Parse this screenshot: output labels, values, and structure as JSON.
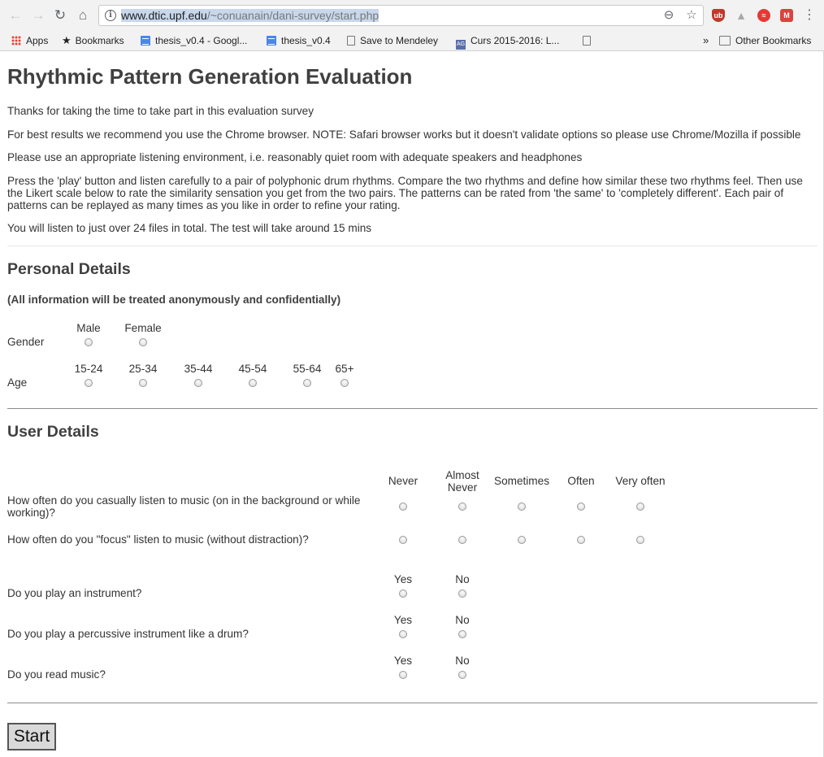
{
  "browser": {
    "url_host": "www.dtic.upf.edu",
    "url_path": "/~conuanain/dani-survey/start.php",
    "bookmarks": [
      {
        "label": "Apps"
      },
      {
        "label": "Bookmarks"
      },
      {
        "label": "thesis_v0.4 - Googl..."
      },
      {
        "label": "thesis_v0.4"
      },
      {
        "label": "Save to Mendeley"
      },
      {
        "label": "Curs 2015-2016: L..."
      }
    ],
    "overflow_label": "»",
    "other_bookmarks": "Other Bookmarks"
  },
  "page": {
    "title": "Rhythmic Pattern Generation Evaluation",
    "intro": [
      "Thanks for taking the time to take part in this evaluation survey",
      "For best results we recommend you use the Chrome browser. NOTE: Safari browser works but it doesn't validate options so please use Chrome/Mozilla if possible",
      "Please use an appropriate listening environment, i.e. reasonably quiet room with adequate speakers and headphones",
      "Press the 'play' button and listen carefully to a pair of polyphonic drum rhythms. Compare the two rhythms and define how similar these two rhythms feel. Then use the Likert scale below to rate the similarity sensation you get from the two pairs. The patterns can be rated from 'the same' to 'completely different'. Each pair of patterns can be replayed as many times as you like in order to refine your rating.",
      "You will listen to just over 24 files in total. The test will take around 15 mins"
    ],
    "personal": {
      "heading": "Personal Details",
      "note": "(All information will be treated anonymously and confidentially)",
      "gender_label": "Gender",
      "gender_options": [
        "Male",
        "Female"
      ],
      "age_label": "Age",
      "age_options": [
        "15-24",
        "25-34",
        "35-44",
        "45-54",
        "55-64",
        "65+"
      ]
    },
    "user": {
      "heading": "User Details",
      "frequency_options": [
        "Never",
        "Almost Never",
        "Sometimes",
        "Often",
        "Very often"
      ],
      "q_casual": "How often do you casually listen to music (on in the background or while working)?",
      "q_focus": "How often do you \"focus\" listen to music (without distraction)?",
      "yes": "Yes",
      "no": "No",
      "q_instrument": "Do you play an instrument?",
      "q_percussive": "Do you play a percussive instrument like a drum?",
      "q_read": "Do you read music?"
    },
    "start_label": "Start"
  },
  "colors": {
    "accent_ublock": "#c0392b",
    "accent_drive": "#a8a8a8",
    "accent_ext_red": "#e53935",
    "accent_ext_pink": "#d8453d"
  }
}
